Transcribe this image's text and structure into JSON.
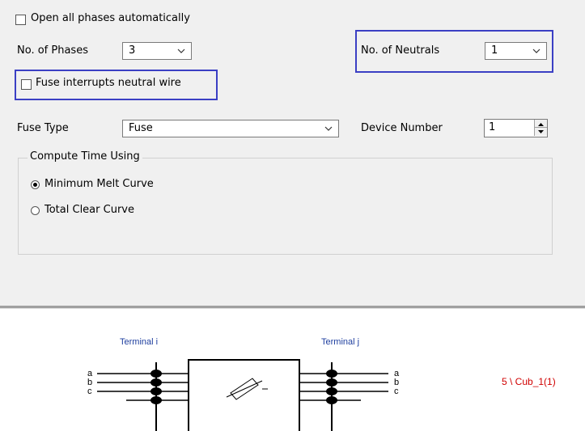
{
  "dialog": {
    "open_all_phases": {
      "label": "Open all phases automatically",
      "checked": false
    },
    "phases": {
      "label": "No. of Phases",
      "value": "3"
    },
    "neutrals": {
      "label": "No. of Neutrals",
      "value": "1"
    },
    "fuse_interrupts": {
      "label": "Fuse interrupts neutral wire",
      "checked": false
    },
    "fuse_type": {
      "label": "Fuse Type",
      "value": "Fuse"
    },
    "device_number": {
      "label": "Device Number",
      "value": "1"
    },
    "compute_time": {
      "title": "Compute Time Using",
      "options": [
        {
          "label": "Minimum Melt Curve",
          "selected": true
        },
        {
          "label": "Total Clear Curve",
          "selected": false
        }
      ]
    },
    "highlight_color": "#3b3fc4"
  },
  "diagram": {
    "terminal_i": "Terminal i",
    "terminal_j": "Terminal j",
    "phases_i": [
      "a",
      "b",
      "c"
    ],
    "phases_j": [
      "a",
      "b",
      "c"
    ],
    "cubicle_label": "5 \\ Cub_1(1)",
    "terminal_color": "#1f3f9f",
    "cubicle_color": "#d00000"
  }
}
